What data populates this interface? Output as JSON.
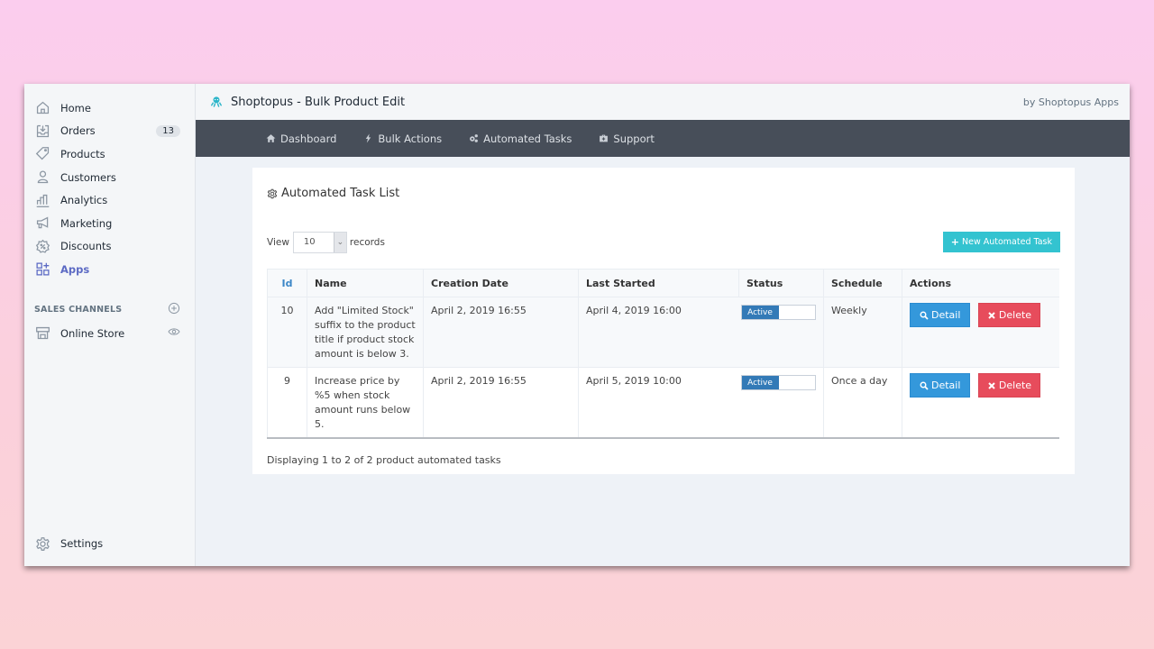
{
  "sidebar": {
    "items": [
      {
        "label": "Home",
        "icon": "home-icon"
      },
      {
        "label": "Orders",
        "icon": "orders-icon",
        "badge": "13"
      },
      {
        "label": "Products",
        "icon": "tag-icon"
      },
      {
        "label": "Customers",
        "icon": "person-icon"
      },
      {
        "label": "Analytics",
        "icon": "bar-chart-icon"
      },
      {
        "label": "Marketing",
        "icon": "megaphone-icon"
      },
      {
        "label": "Discounts",
        "icon": "discount-icon"
      },
      {
        "label": "Apps",
        "icon": "apps-icon",
        "active": true
      }
    ],
    "sales_channels": {
      "title": "SALES CHANNELS",
      "items": [
        {
          "label": "Online Store",
          "icon": "store-icon"
        }
      ]
    },
    "settings_label": "Settings"
  },
  "topbar": {
    "title": "Shoptopus - Bulk Product Edit",
    "by_line": "by Shoptopus Apps"
  },
  "menu": [
    {
      "label": "Dashboard",
      "icon": "home-icon"
    },
    {
      "label": "Bulk Actions",
      "icon": "bolt-icon"
    },
    {
      "label": "Automated Tasks",
      "icon": "cogs-icon"
    },
    {
      "label": "Support",
      "icon": "medkit-icon"
    }
  ],
  "card": {
    "title": "Automated Task List",
    "view_label": "View",
    "records_value": "10",
    "records_label": "records",
    "new_button": "New Automated Task",
    "footer": "Displaying 1 to 2 of 2 product automated tasks"
  },
  "table": {
    "headers": [
      "Id",
      "Name",
      "Creation Date",
      "Last Started",
      "Status",
      "Schedule",
      "Actions"
    ],
    "rows": [
      {
        "id": "10",
        "name": "Add \"Limited Stock\" suffix to the product title if product stock amount is below 3.",
        "created": "April 2, 2019 16:55",
        "last_started": "April 4, 2019 16:00",
        "status": "Active",
        "schedule": "Weekly",
        "detail": "Detail",
        "delete": "Delete"
      },
      {
        "id": "9",
        "name": "Increase price by %5 when stock amount runs below 5.",
        "created": "April 2, 2019 16:55",
        "last_started": "April 5, 2019 10:00",
        "status": "Active",
        "schedule": "Once a day",
        "detail": "Detail",
        "delete": "Delete"
      }
    ]
  },
  "colors": {
    "accent_apps": "#5c6ac4",
    "menubar": "#474e59",
    "new_button": "#33c3d0",
    "detail_button": "#3498db",
    "delete_button": "#e74c5c",
    "status_active": "#337ab7"
  }
}
